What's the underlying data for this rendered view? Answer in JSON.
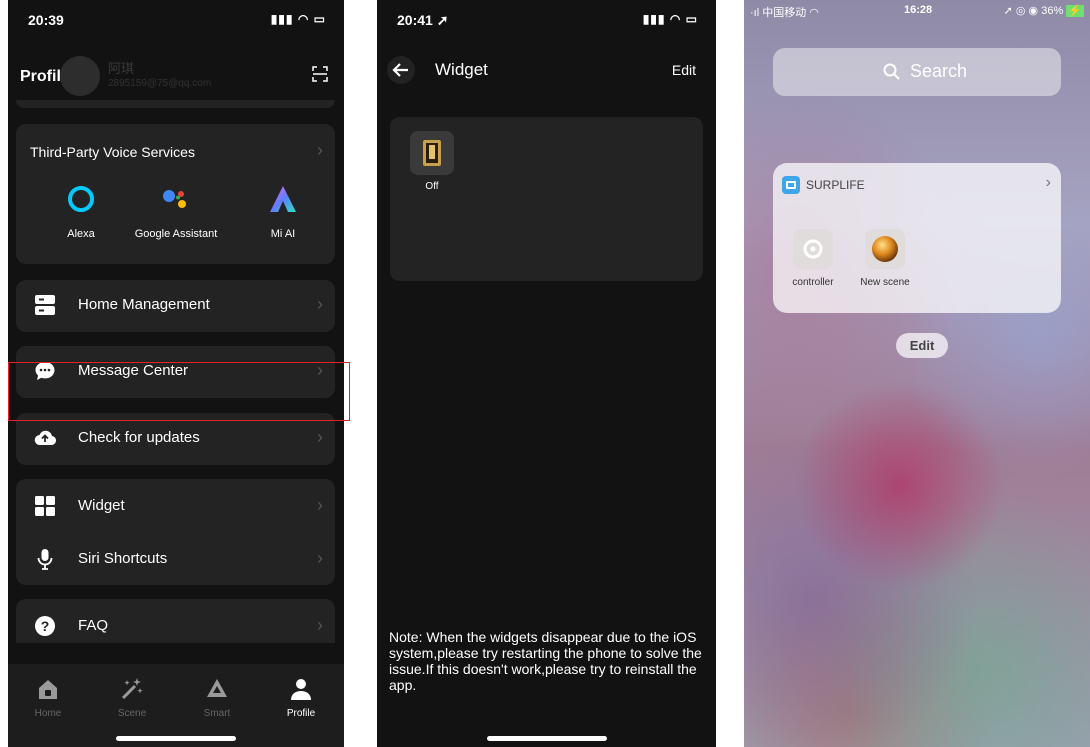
{
  "panel1": {
    "time": "20:39",
    "signal": "▮▮▮ ◠ ▭",
    "header_title": "Profile",
    "user_name": "阿琪",
    "user_email": "2895159@75@qq.com",
    "voice_title": "Third-Party Voice Services",
    "voice_services": [
      "Alexa",
      "Google Assistant",
      "Mi AI"
    ],
    "menu": [
      "Home Management",
      "Message Center",
      "Check for updates",
      "Widget",
      "Siri Shortcuts",
      "FAQ"
    ],
    "tabs": [
      "Home",
      "Scene",
      "Smart",
      "Profile"
    ],
    "highlight_color": "#e0222a"
  },
  "panel2": {
    "time": "20:41",
    "signal": "▮▮▮ ◠ ▭",
    "title": "Widget",
    "edit": "Edit",
    "widget_label": "Off",
    "note": "Note: When the widgets disappear due to the iOS system,please try restarting the phone to solve the issue.If this doesn't work,please try to reinstall the app."
  },
  "panel3": {
    "carrier": "中国移动",
    "time": "16:28",
    "battery": "36%",
    "search_placeholder": "Search",
    "widget_title": "SURPLIFE",
    "items": [
      "controller",
      "New scene"
    ],
    "edit_button": "Edit"
  }
}
